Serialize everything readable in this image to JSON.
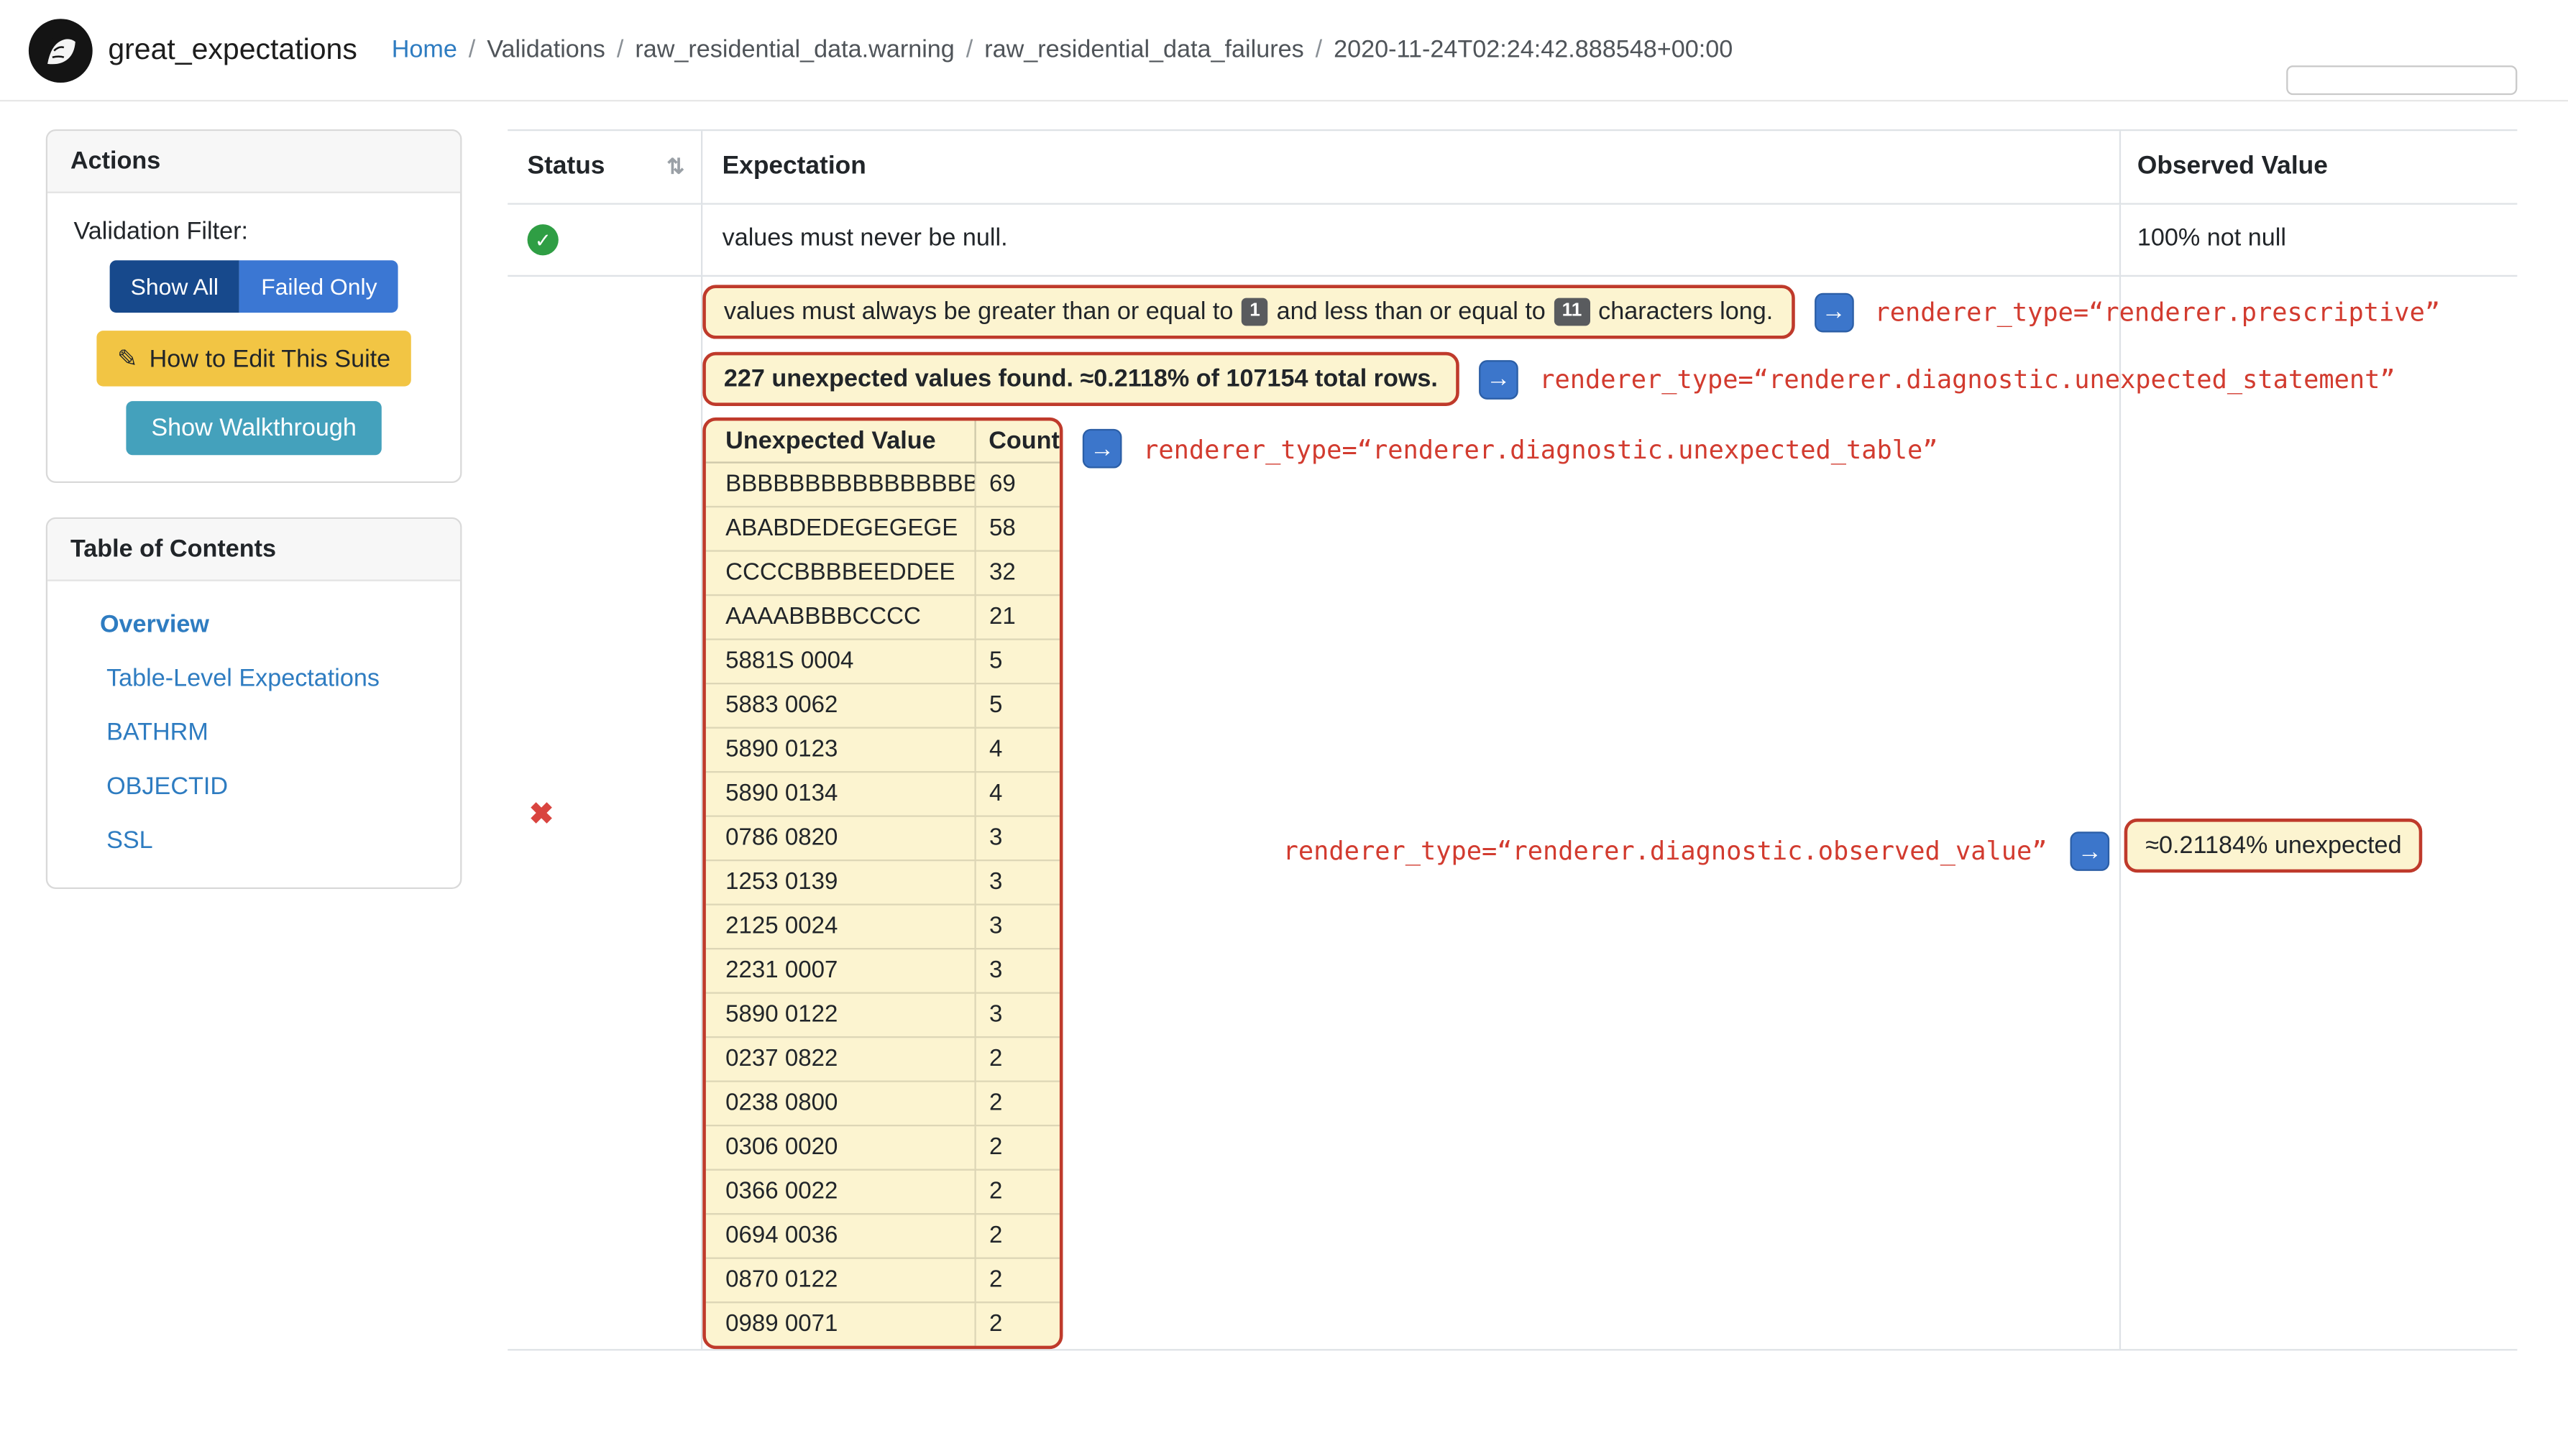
{
  "colors": {
    "link_blue": "#2e7cc1",
    "primary_dark": "#17498c",
    "primary": "#3b77d3",
    "warning_yellow": "#f2c544",
    "info_teal": "#44a1bc",
    "highlight_bg": "#fcf4d0",
    "highlight_border": "#bf3a2b",
    "code_red": "#d23b2f",
    "accent_blue": "#3c76cb",
    "success_green": "#2f9e44",
    "fail_red": "#d9443f"
  },
  "icons": {
    "sort": "⇅",
    "check": "✓",
    "fail": "✖",
    "arrow": "→",
    "edit": "✎"
  },
  "navbar": {
    "brand": "great_expectations",
    "breadcrumb": {
      "home": "Home",
      "separator": "/",
      "items": [
        "Validations",
        "raw_residential_data.warning",
        "raw_residential_data_failures",
        "2020-11-24T02:24:42.888548+00:00"
      ]
    }
  },
  "sidebar": {
    "actions": {
      "title": "Actions",
      "filter_label": "Validation Filter:",
      "show_all": "Show All",
      "failed_only": "Failed Only",
      "edit_suite": "How to Edit This Suite",
      "walkthrough": "Show Walkthrough"
    },
    "toc": {
      "title": "Table of Contents",
      "items": [
        {
          "label": "Overview"
        },
        {
          "label": "Table-Level Expectations"
        },
        {
          "label": "BATHRM"
        },
        {
          "label": "OBJECTID"
        },
        {
          "label": "SSL"
        }
      ]
    }
  },
  "table": {
    "headers": {
      "status": "Status",
      "expectation": "Expectation",
      "observed": "Observed Value"
    },
    "row1": {
      "expectation": "values must never be null.",
      "observed": "100% not null"
    },
    "row2": {
      "prescriptive": {
        "text_before": "values must always be greater than or equal to",
        "badge1": "1",
        "text_mid": "and less than or equal to",
        "badge2": "11",
        "text_after": "characters long.",
        "renderer": "renderer_type=“renderer.prescriptive”"
      },
      "unexpected_statement": {
        "text": "227 unexpected values found. ≈0.2118% of 107154 total rows.",
        "renderer": "renderer_type=“renderer.diagnostic.unexpected_statement”"
      },
      "unexpected_table": {
        "renderer": "renderer_type=“renderer.diagnostic.unexpected_table”",
        "headers": [
          "Unexpected Value",
          "Count"
        ],
        "rows": [
          {
            "value": "BBBBBBBBBBBBBBBB",
            "count": 69
          },
          {
            "value": "ABABDEDEGEGEGE",
            "count": 58
          },
          {
            "value": "CCCCBBBBEEDDEE",
            "count": 32
          },
          {
            "value": "AAAABBBBCCCC",
            "count": 21
          },
          {
            "value": "5881S 0004",
            "count": 5
          },
          {
            "value": "5883 0062",
            "count": 5
          },
          {
            "value": "5890 0123",
            "count": 4
          },
          {
            "value": "5890 0134",
            "count": 4
          },
          {
            "value": "0786 0820",
            "count": 3
          },
          {
            "value": "1253 0139",
            "count": 3
          },
          {
            "value": "2125 0024",
            "count": 3
          },
          {
            "value": "2231 0007",
            "count": 3
          },
          {
            "value": "5890 0122",
            "count": 3
          },
          {
            "value": "0237 0822",
            "count": 2
          },
          {
            "value": "0238 0800",
            "count": 2
          },
          {
            "value": "0306 0020",
            "count": 2
          },
          {
            "value": "0366 0022",
            "count": 2
          },
          {
            "value": "0694 0036",
            "count": 2
          },
          {
            "value": "0870 0122",
            "count": 2
          },
          {
            "value": "0989 0071",
            "count": 2
          }
        ]
      },
      "observed_value": {
        "renderer": "renderer_type=“renderer.diagnostic.observed_value”",
        "value": "≈0.21184% unexpected"
      }
    }
  }
}
